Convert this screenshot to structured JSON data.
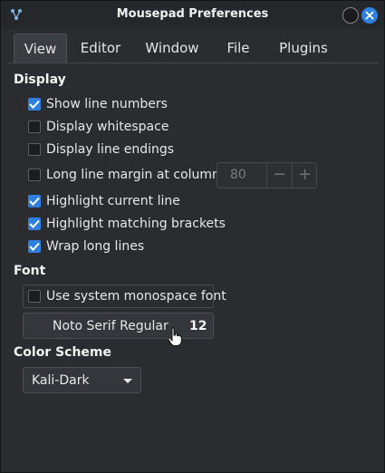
{
  "window": {
    "title": "Mousepad Preferences"
  },
  "tabs": [
    {
      "label": "View",
      "active": true
    },
    {
      "label": "Editor",
      "active": false
    },
    {
      "label": "Window",
      "active": false
    },
    {
      "label": "File",
      "active": false
    },
    {
      "label": "Plugins",
      "active": false
    }
  ],
  "display": {
    "heading": "Display",
    "options": [
      {
        "label": "Show line numbers",
        "checked": true
      },
      {
        "label": "Display whitespace",
        "checked": false
      },
      {
        "label": "Display line endings",
        "checked": false
      },
      {
        "label": "Long line margin at column:",
        "checked": false
      },
      {
        "label": "Highlight current line",
        "checked": true
      },
      {
        "label": "Highlight matching brackets",
        "checked": true
      },
      {
        "label": "Wrap long lines",
        "checked": true
      }
    ],
    "margin_column": {
      "value": "80",
      "decrement": "−",
      "increment": "+",
      "enabled": false
    }
  },
  "font": {
    "heading": "Font",
    "use_system_font": {
      "label": "Use system monospace font",
      "checked": false
    },
    "font_name": "Noto Serif Regular",
    "font_size": "12"
  },
  "color_scheme": {
    "heading": "Color Scheme",
    "selected": "Kali-Dark"
  },
  "colors": {
    "accent": "#2f7fe0",
    "background": "#2a2c30"
  },
  "icons": {
    "app": "mousepad-app-icon",
    "minimize": "minimize-icon",
    "close": "close-icon",
    "cursor": "hand-pointer-icon"
  }
}
